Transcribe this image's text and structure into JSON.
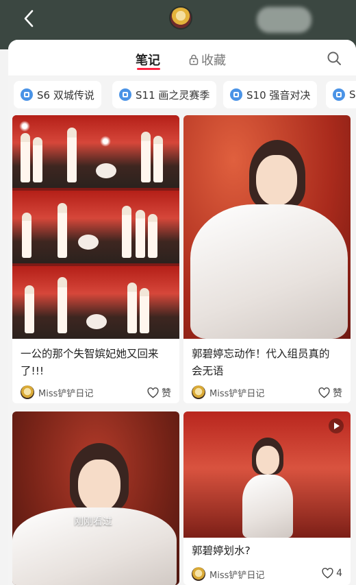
{
  "header": {
    "back_icon": "chevron-left-icon"
  },
  "tabs": {
    "notes_label": "笔记",
    "favorites_label": "收藏",
    "favorites_icon": "lock-icon",
    "search_icon": "search-icon",
    "active_color": "#ff2442"
  },
  "chips": [
    {
      "label": "S6 双城传说"
    },
    {
      "label": "S11 画之灵赛季"
    },
    {
      "label": "S10 强音对决"
    },
    {
      "label": "S"
    }
  ],
  "feed": [
    {
      "title_line1": "一公的那个失智嫔妃她又回来",
      "title_line2": "了!!!",
      "author": "Miss铲铲日记",
      "like": "赞"
    },
    {
      "title_line1": "郭碧婷忘动作！代入组员真的",
      "title_line2": "会无语",
      "author": "Miss铲铲日记",
      "like": "赞"
    },
    {
      "overlay": "刚刚看过"
    },
    {
      "title_line1": "郭碧婷划水?",
      "author": "Miss铲铲日记",
      "like": "4"
    }
  ]
}
